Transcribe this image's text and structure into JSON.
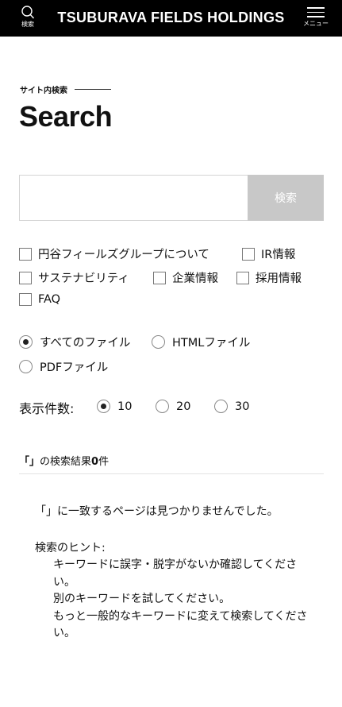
{
  "header": {
    "search_label": "検索",
    "site_title": "TSUBURAVA FIELDS HOLDINGS",
    "menu_label": "メニュー"
  },
  "section": {
    "eyebrow": "サイト内検索",
    "title": "Search"
  },
  "search": {
    "value": "",
    "placeholder": "",
    "button_label": "検索"
  },
  "categories": [
    {
      "label": "円谷フィールズグループについて",
      "checked": false
    },
    {
      "label": "IR情報",
      "checked": false
    },
    {
      "label": "サステナビリティ",
      "checked": false
    },
    {
      "label": "企業情報",
      "checked": false
    },
    {
      "label": "採用情報",
      "checked": false
    },
    {
      "label": "FAQ",
      "checked": false
    }
  ],
  "file_types": [
    {
      "label": "すべてのファイル",
      "selected": true
    },
    {
      "label": "HTMLファイル",
      "selected": false
    },
    {
      "label": "PDFファイル",
      "selected": false
    }
  ],
  "display_count": {
    "label": "表示件数:",
    "options": [
      {
        "label": "10",
        "selected": true
      },
      {
        "label": "20",
        "selected": false
      },
      {
        "label": "30",
        "selected": false
      }
    ]
  },
  "results": {
    "query_quote": "「」",
    "heading_mid": "の検索結果",
    "count": "0",
    "heading_end": "件",
    "no_match": "「」に一致するページは見つかりませんでした。",
    "hint_title": "検索のヒント:",
    "hints": [
      "キーワードに誤字・脱字がないか確認してください。",
      "別のキーワードを試してください。",
      "もっと一般的なキーワードに変えて検索してください。"
    ]
  }
}
